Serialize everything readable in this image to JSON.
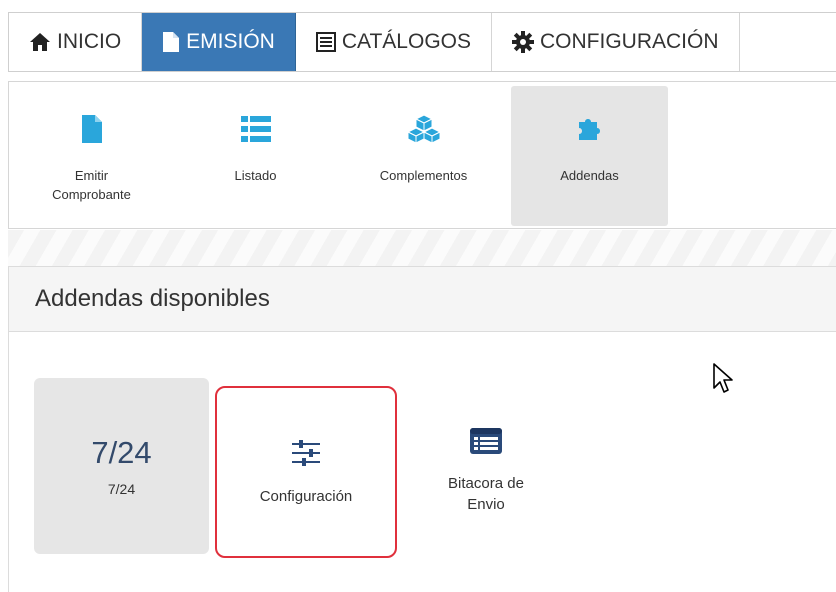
{
  "nav": {
    "tabs": [
      {
        "label": "INICIO",
        "icon": "home-icon",
        "active": false
      },
      {
        "label": "EMISIÓN",
        "icon": "file-icon",
        "active": true
      },
      {
        "label": "CATÁLOGOS",
        "icon": "list-alt-icon",
        "active": false
      },
      {
        "label": "CONFIGURACIÓN",
        "icon": "gear-icon",
        "active": false
      }
    ]
  },
  "toolbar": {
    "items": [
      {
        "label": "Emitir Comprobante",
        "icon": "file-icon",
        "active": false
      },
      {
        "label": "Listado",
        "icon": "list-icon",
        "active": false
      },
      {
        "label": "Complementos",
        "icon": "cubes-icon",
        "active": false
      },
      {
        "label": "Addendas",
        "icon": "puzzle-icon",
        "active": true
      }
    ]
  },
  "panel": {
    "title": "Addendas disponibles",
    "cards": [
      {
        "big": "7/24",
        "label": "7/24"
      },
      {
        "label": "Configuración",
        "icon": "sliders-icon"
      },
      {
        "label": "Bitacora de Envio",
        "icon": "log-list-icon"
      }
    ]
  },
  "colors": {
    "accent": "#3a78b5",
    "toolbar_icon": "#2aa6db",
    "highlight_border": "#e0303c"
  }
}
